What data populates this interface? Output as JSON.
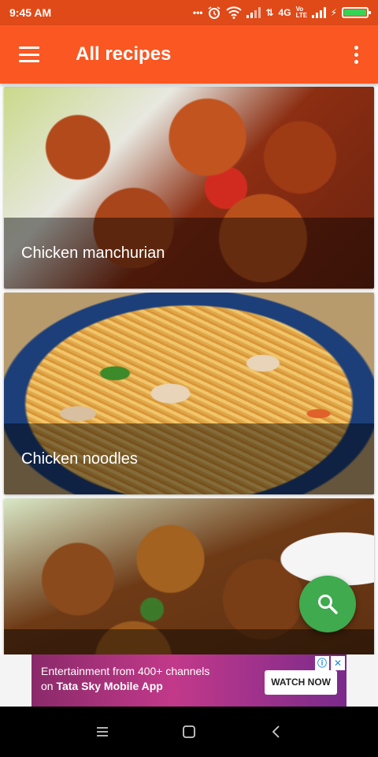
{
  "status_bar": {
    "time": "9:45 AM",
    "network": "4G",
    "volte": "Vo LTE",
    "icons": [
      "more-dots-icon",
      "alarm-icon",
      "wifi-icon",
      "signal-icon",
      "data-arrows-icon",
      "volte-icon",
      "signal-icon",
      "charging-icon",
      "battery-icon"
    ]
  },
  "app_bar": {
    "title": "All recipes",
    "color": "#fa5722"
  },
  "recipes": [
    {
      "name": "Chicken manchurian"
    },
    {
      "name": "Chicken noodles"
    },
    {
      "name": ""
    }
  ],
  "fab": {
    "icon": "search-icon",
    "color": "#3faa4e"
  },
  "ad": {
    "line1": "Entertainment from 400+ channels",
    "line2_prefix": "on ",
    "line2_bold": "Tata Sky Mobile App",
    "cta": "WATCH NOW"
  },
  "nav": {
    "icons": [
      "recents-icon",
      "home-icon",
      "back-icon"
    ]
  }
}
